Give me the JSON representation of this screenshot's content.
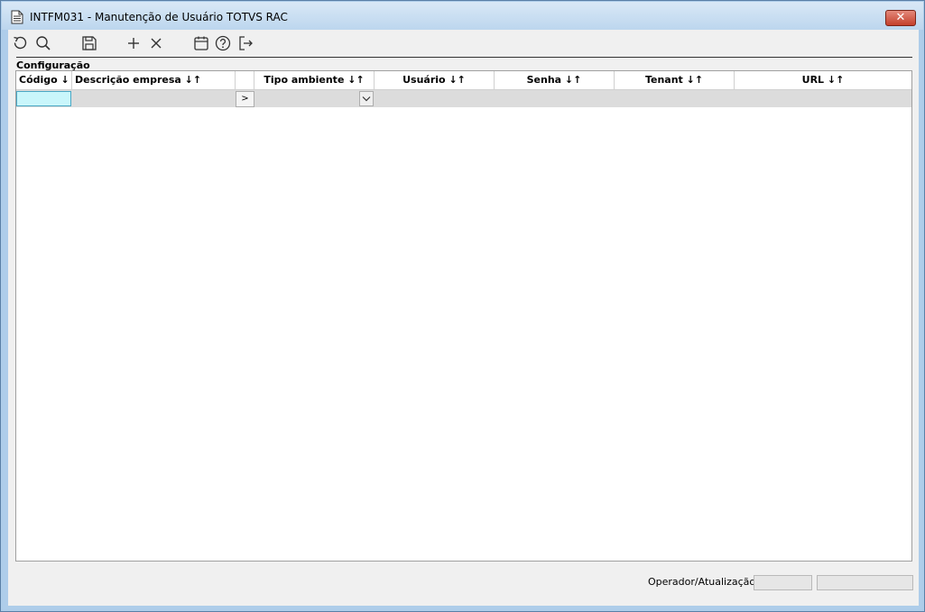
{
  "window": {
    "title": "INTFM031 - Manutenção de Usuário TOTVS RAC",
    "title_icon": "document-icon",
    "close_icon": "close-icon",
    "close_glyph": "✕"
  },
  "toolbar": {
    "buttons": [
      {
        "icon": "refresh-icon"
      },
      {
        "icon": "search-icon"
      },
      {
        "icon": "save-icon"
      },
      {
        "icon": "add-icon"
      },
      {
        "icon": "delete-icon"
      },
      {
        "icon": "calendar-icon"
      },
      {
        "icon": "help-icon"
      },
      {
        "icon": "exit-icon"
      }
    ]
  },
  "group": {
    "label": "Configuração"
  },
  "grid": {
    "columns": [
      {
        "label": "Código ↓↑"
      },
      {
        "label": "Descrição empresa ↓↑"
      },
      {
        "label": ""
      },
      {
        "label": "Tipo ambiente ↓↑"
      },
      {
        "label": "Usuário ↓↑"
      },
      {
        "label": "Senha ↓↑"
      },
      {
        "label": "Tenant ↓↑"
      },
      {
        "label": "URL ↓↑"
      }
    ],
    "row": {
      "codigo": "",
      "descricao": "",
      "arrow_label": ">",
      "tipo_ambiente": "",
      "usuario": "",
      "senha": "",
      "tenant": "",
      "url": ""
    }
  },
  "footer": {
    "operador_label": "Operador/Atualização",
    "operador": "",
    "atualizacao": ""
  },
  "colors": {
    "title_bar": "#bcd6ee",
    "client_bg": "#f0f0f0",
    "active_cell": "#c9f6fb",
    "row_bg": "#dcdcdc",
    "close_button": "#c4402c"
  }
}
